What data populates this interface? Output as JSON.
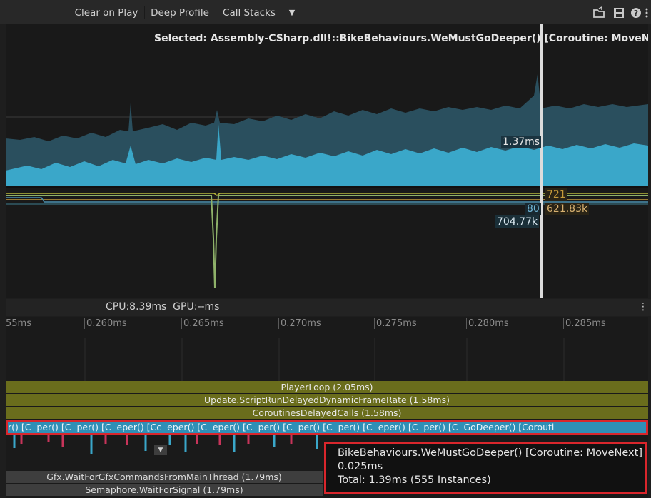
{
  "toolbar": {
    "clear_on_play": "Clear on Play",
    "deep_profile": "Deep Profile",
    "call_stacks": "Call Stacks",
    "dropdown_glyph": "▼",
    "icons": [
      "load-icon",
      "save-icon",
      "help-icon",
      "more-icon"
    ]
  },
  "chart": {
    "selected_label": "Selected: Assembly-CSharp.dll!::BikeBehaviours.WeMustGoDeeper() [Coroutine: MoveNext]",
    "cpu_value_label": "1.37ms",
    "stat_labels": {
      "a": "721",
      "b": "80",
      "c": "621.83k",
      "d": "704.77k"
    }
  },
  "status": {
    "cpu_gpu": "CPU:8.39ms  GPU:--ms",
    "more_glyph": "⋮"
  },
  "ruler": {
    "ticks": [
      "55ms",
      "0.260ms",
      "0.265ms",
      "0.270ms",
      "0.275ms",
      "0.280ms",
      "0.285ms"
    ]
  },
  "timeline": {
    "player_loop": "PlayerLoop (2.05ms)",
    "update_script": "Update.ScriptRunDelayedDynamicFrameRate (1.58ms)",
    "coroutines_delayed": "CoroutinesDelayedCalls (1.58ms)",
    "coroutine_strip_text": "r() [C  per() [C  per() [C  eper() [Cc  eper() [C  eper() [C  per() [C  per() [C  per() [C  eper() [C  per() [C  GoDeeper() [Corouti",
    "gfx_wait": "Gfx.WaitForGfxCommandsFromMainThread (1.79ms)",
    "semaphore": "Semaphore.WaitForSignal (1.79ms)",
    "expand_glyph": "▼"
  },
  "tooltip": {
    "name": "BikeBehaviours.WeMustGoDeeper() [Coroutine: MoveNext]",
    "self_time": "0.025ms",
    "total": "Total: 1.39ms (555 Instances)"
  },
  "colors": {
    "cpu_area_dark": "#2a4f5e",
    "cpu_area_light": "#3aa7c9",
    "selection_highlight": "#d9262c",
    "olive_bar": "#6a6d1c",
    "line_orange": "#c59a3a",
    "line_yellow": "#b8b83a",
    "line_green": "#8fb26a",
    "line_blue": "#4a8fb0"
  }
}
